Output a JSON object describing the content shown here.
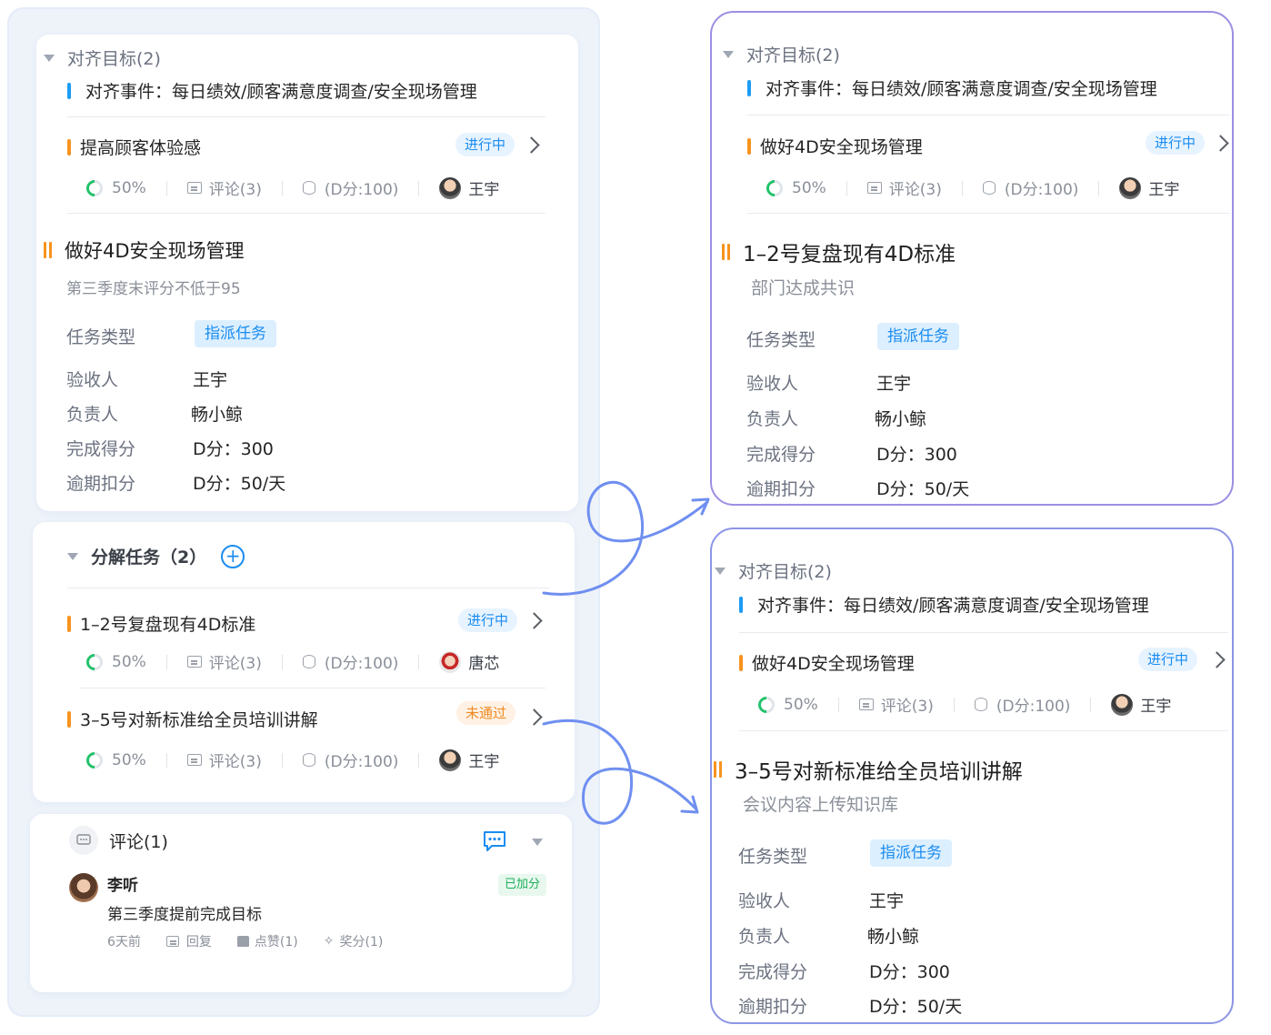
{
  "left": {
    "align": {
      "title": "对齐目标(2)",
      "event": "对齐事件：每日绩效/顾客满意度调查/安全现场管理",
      "sub_task": {
        "name": "提高顾客体验感",
        "status": "进行中",
        "progress": "50%",
        "comments": "评论(3)",
        "score": "(D分:100)",
        "owner": "王宇"
      }
    },
    "main_task": {
      "title": "做好4D安全现场管理",
      "desc": "第三季度末评分不低于95",
      "fields": [
        {
          "label": "任务类型",
          "value": "指派任务"
        },
        {
          "label": "验收人",
          "value": "王宇"
        },
        {
          "label": "负责人",
          "value": "畅小鲸"
        },
        {
          "label": "完成得分",
          "value": "D分：300"
        },
        {
          "label": "逾期扣分",
          "value": "D分：50/天"
        }
      ]
    },
    "breakdown": {
      "title": "分解任务（2）",
      "add_symbol": "+",
      "items": [
        {
          "name": "1–2号复盘现有4D标准",
          "status": "进行中",
          "progress": "50%",
          "comments": "评论(3)",
          "score": "(D分:100)",
          "owner": "唐芯"
        },
        {
          "name": "3–5号对新标准给全员培训讲解",
          "status": "未通过",
          "progress": "50%",
          "comments": "评论(3)",
          "score": "(D分:100)",
          "owner": "王宇"
        }
      ]
    },
    "comments": {
      "title": "评论(1)",
      "user": "李听",
      "badge": "已加分",
      "text": "第三季度提前完成目标",
      "time": "6天前",
      "reply": "回复",
      "like": "点赞(1)",
      "reward": "奖分(1)"
    }
  },
  "right_top": {
    "align_title": "对齐目标(2)",
    "event": "对齐事件：每日绩效/顾客满意度调查/安全现场管理",
    "parent": {
      "name": "做好4D安全现场管理",
      "status": "进行中",
      "progress": "50%",
      "comments": "评论(3)",
      "score": "(D分:100)",
      "owner": "王宇"
    },
    "title": "1–2号复盘现有4D标准",
    "desc": "部门达成共识",
    "fields": [
      {
        "label": "任务类型",
        "value": "指派任务"
      },
      {
        "label": "验收人",
        "value": "王宇"
      },
      {
        "label": "负责人",
        "value": "畅小鲸"
      },
      {
        "label": "完成得分",
        "value": "D分：300"
      },
      {
        "label": "逾期扣分",
        "value": "D分：50/天"
      }
    ]
  },
  "right_bottom": {
    "align_title": "对齐目标(2)",
    "event": "对齐事件：每日绩效/顾客满意度调查/安全现场管理",
    "parent": {
      "name": "做好4D安全现场管理",
      "status": "进行中",
      "progress": "50%",
      "comments": "评论(3)",
      "score": "(D分:100)",
      "owner": "王宇"
    },
    "title": "3–5号对新标准给全员培训讲解",
    "desc": "会议内容上传知识库",
    "fields": [
      {
        "label": "任务类型",
        "value": "指派任务"
      },
      {
        "label": "验收人",
        "value": "王宇"
      },
      {
        "label": "负责人",
        "value": "畅小鲸"
      },
      {
        "label": "完成得分",
        "value": "D分：300"
      },
      {
        "label": "逾期扣分",
        "value": "D分：50/天"
      }
    ]
  },
  "colors": {
    "accent_blue": "#1a8cf0",
    "accent_orange": "#f7931e",
    "progress_green": "#22c26a",
    "pane_border": "#9a8fe3",
    "arrow": "#6f8ff0"
  }
}
